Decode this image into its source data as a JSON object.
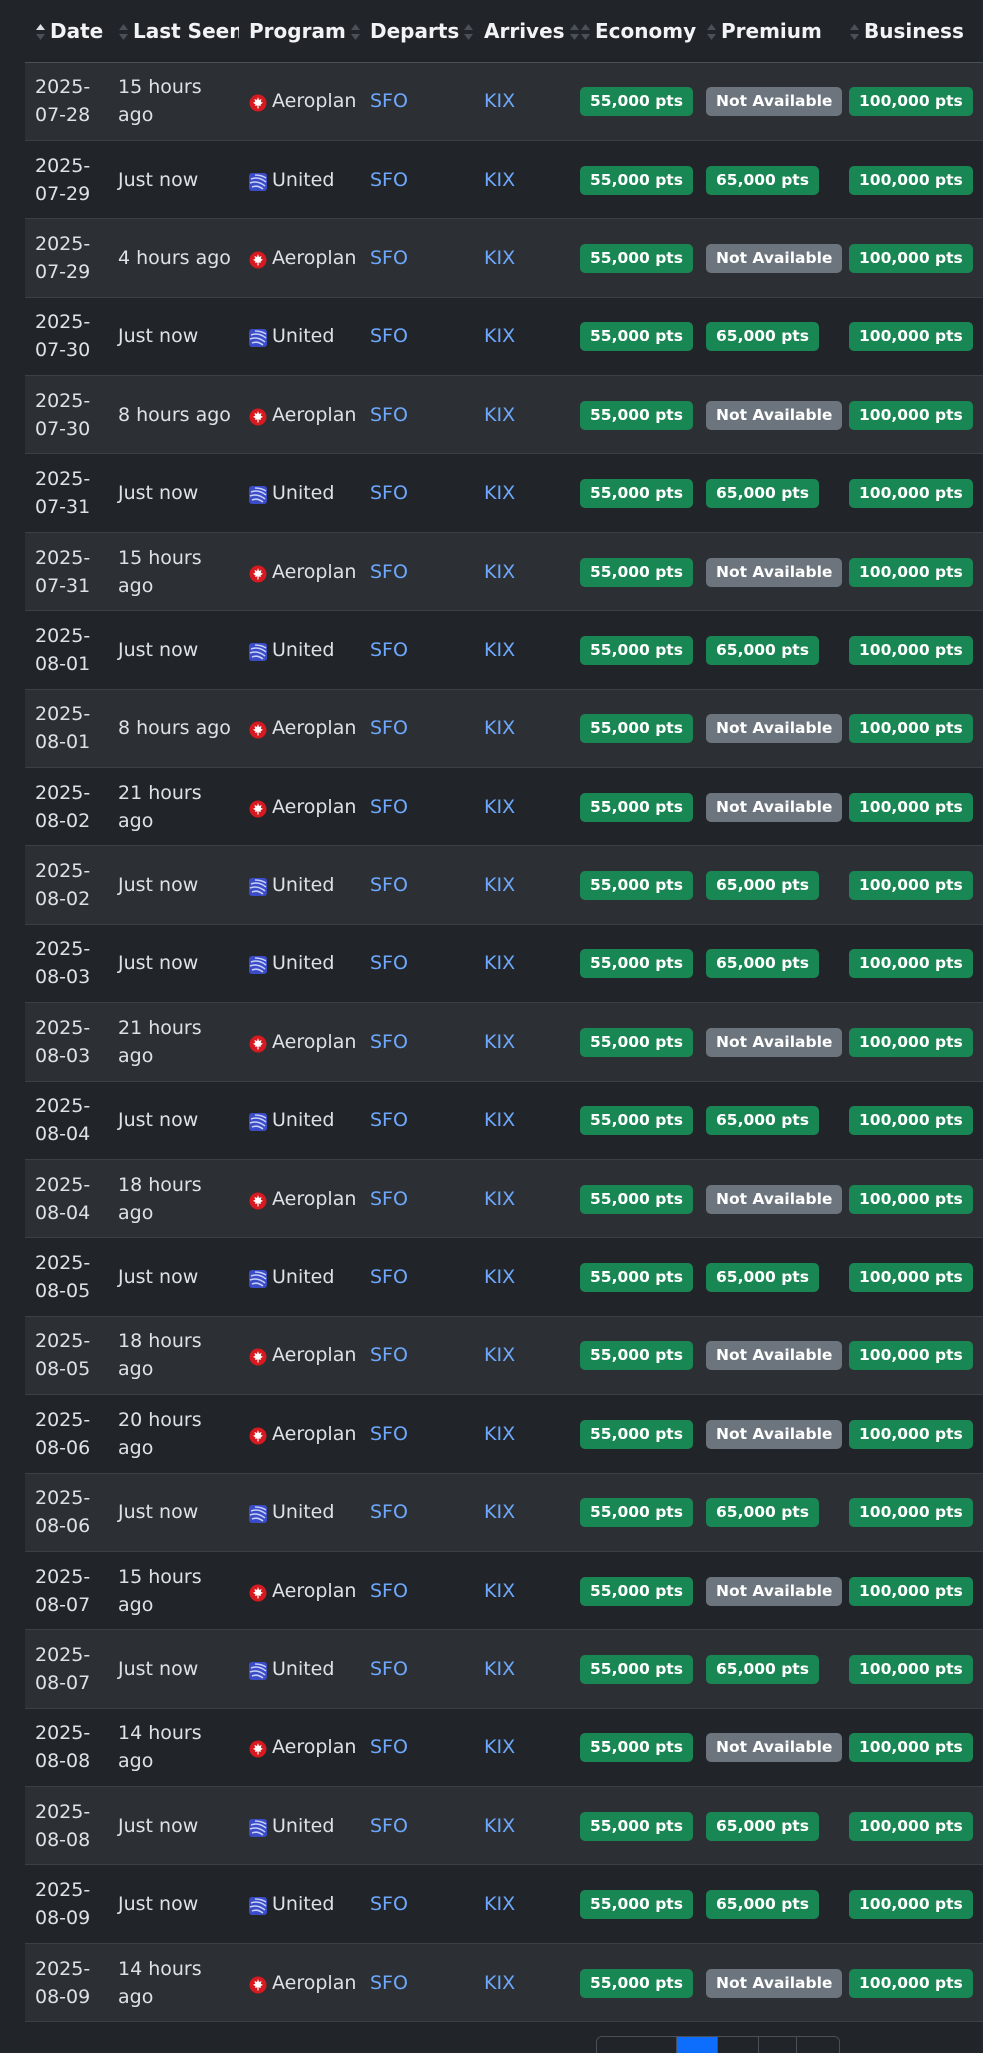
{
  "columns": {
    "date": "Date",
    "last_seen": "Last Seen",
    "program": "Program",
    "departs": "Departs",
    "arrives": "Arrives",
    "economy": "Economy",
    "premium": "Premium",
    "business": "Business"
  },
  "colors": {
    "available": "#198754",
    "not_available": "#6c757d",
    "link": "#6ea8fe",
    "active_page": "#0d6efd"
  },
  "icons": {
    "aeroplan": "aeroplan-maple-leaf-icon",
    "united": "united-globe-icon"
  },
  "rows": [
    {
      "date": "2025-\n07-28",
      "last_seen": "15 hours\nago",
      "program": "Aeroplan",
      "departs": "SFO",
      "arrives": "KIX",
      "economy": "55,000 pts",
      "premium": "Not Available",
      "business": "100,000 pts"
    },
    {
      "date": "2025-\n07-29",
      "last_seen": "Just now",
      "program": "United",
      "departs": "SFO",
      "arrives": "KIX",
      "economy": "55,000 pts",
      "premium": "65,000 pts",
      "business": "100,000 pts"
    },
    {
      "date": "2025-\n07-29",
      "last_seen": "4 hours ago",
      "program": "Aeroplan",
      "departs": "SFO",
      "arrives": "KIX",
      "economy": "55,000 pts",
      "premium": "Not Available",
      "business": "100,000 pts"
    },
    {
      "date": "2025-\n07-30",
      "last_seen": "Just now",
      "program": "United",
      "departs": "SFO",
      "arrives": "KIX",
      "economy": "55,000 pts",
      "premium": "65,000 pts",
      "business": "100,000 pts"
    },
    {
      "date": "2025-\n07-30",
      "last_seen": "8 hours ago",
      "program": "Aeroplan",
      "departs": "SFO",
      "arrives": "KIX",
      "economy": "55,000 pts",
      "premium": "Not Available",
      "business": "100,000 pts"
    },
    {
      "date": "2025-\n07-31",
      "last_seen": "Just now",
      "program": "United",
      "departs": "SFO",
      "arrives": "KIX",
      "economy": "55,000 pts",
      "premium": "65,000 pts",
      "business": "100,000 pts"
    },
    {
      "date": "2025-\n07-31",
      "last_seen": "15 hours\nago",
      "program": "Aeroplan",
      "departs": "SFO",
      "arrives": "KIX",
      "economy": "55,000 pts",
      "premium": "Not Available",
      "business": "100,000 pts"
    },
    {
      "date": "2025-\n08-01",
      "last_seen": "Just now",
      "program": "United",
      "departs": "SFO",
      "arrives": "KIX",
      "economy": "55,000 pts",
      "premium": "65,000 pts",
      "business": "100,000 pts"
    },
    {
      "date": "2025-\n08-01",
      "last_seen": "8 hours ago",
      "program": "Aeroplan",
      "departs": "SFO",
      "arrives": "KIX",
      "economy": "55,000 pts",
      "premium": "Not Available",
      "business": "100,000 pts"
    },
    {
      "date": "2025-\n08-02",
      "last_seen": "21 hours\nago",
      "program": "Aeroplan",
      "departs": "SFO",
      "arrives": "KIX",
      "economy": "55,000 pts",
      "premium": "Not Available",
      "business": "100,000 pts"
    },
    {
      "date": "2025-\n08-02",
      "last_seen": "Just now",
      "program": "United",
      "departs": "SFO",
      "arrives": "KIX",
      "economy": "55,000 pts",
      "premium": "65,000 pts",
      "business": "100,000 pts"
    },
    {
      "date": "2025-\n08-03",
      "last_seen": "Just now",
      "program": "United",
      "departs": "SFO",
      "arrives": "KIX",
      "economy": "55,000 pts",
      "premium": "65,000 pts",
      "business": "100,000 pts"
    },
    {
      "date": "2025-\n08-03",
      "last_seen": "21 hours\nago",
      "program": "Aeroplan",
      "departs": "SFO",
      "arrives": "KIX",
      "economy": "55,000 pts",
      "premium": "Not Available",
      "business": "100,000 pts"
    },
    {
      "date": "2025-\n08-04",
      "last_seen": "Just now",
      "program": "United",
      "departs": "SFO",
      "arrives": "KIX",
      "economy": "55,000 pts",
      "premium": "65,000 pts",
      "business": "100,000 pts"
    },
    {
      "date": "2025-\n08-04",
      "last_seen": "18 hours\nago",
      "program": "Aeroplan",
      "departs": "SFO",
      "arrives": "KIX",
      "economy": "55,000 pts",
      "premium": "Not Available",
      "business": "100,000 pts"
    },
    {
      "date": "2025-\n08-05",
      "last_seen": "Just now",
      "program": "United",
      "departs": "SFO",
      "arrives": "KIX",
      "economy": "55,000 pts",
      "premium": "65,000 pts",
      "business": "100,000 pts"
    },
    {
      "date": "2025-\n08-05",
      "last_seen": "18 hours\nago",
      "program": "Aeroplan",
      "departs": "SFO",
      "arrives": "KIX",
      "economy": "55,000 pts",
      "premium": "Not Available",
      "business": "100,000 pts"
    },
    {
      "date": "2025-\n08-06",
      "last_seen": "20 hours\nago",
      "program": "Aeroplan",
      "departs": "SFO",
      "arrives": "KIX",
      "economy": "55,000 pts",
      "premium": "Not Available",
      "business": "100,000 pts"
    },
    {
      "date": "2025-\n08-06",
      "last_seen": "Just now",
      "program": "United",
      "departs": "SFO",
      "arrives": "KIX",
      "economy": "55,000 pts",
      "premium": "65,000 pts",
      "business": "100,000 pts"
    },
    {
      "date": "2025-\n08-07",
      "last_seen": "15 hours\nago",
      "program": "Aeroplan",
      "departs": "SFO",
      "arrives": "KIX",
      "economy": "55,000 pts",
      "premium": "Not Available",
      "business": "100,000 pts"
    },
    {
      "date": "2025-\n08-07",
      "last_seen": "Just now",
      "program": "United",
      "departs": "SFO",
      "arrives": "KIX",
      "economy": "55,000 pts",
      "premium": "65,000 pts",
      "business": "100,000 pts"
    },
    {
      "date": "2025-\n08-08",
      "last_seen": "14 hours\nago",
      "program": "Aeroplan",
      "departs": "SFO",
      "arrives": "KIX",
      "economy": "55,000 pts",
      "premium": "Not Available",
      "business": "100,000 pts"
    },
    {
      "date": "2025-\n08-08",
      "last_seen": "Just now",
      "program": "United",
      "departs": "SFO",
      "arrives": "KIX",
      "economy": "55,000 pts",
      "premium": "65,000 pts",
      "business": "100,000 pts"
    },
    {
      "date": "2025-\n08-09",
      "last_seen": "Just now",
      "program": "United",
      "departs": "SFO",
      "arrives": "KIX",
      "economy": "55,000 pts",
      "premium": "65,000 pts",
      "business": "100,000 pts"
    },
    {
      "date": "2025-\n08-09",
      "last_seen": "14 hours\nago",
      "program": "Aeroplan",
      "departs": "SFO",
      "arrives": "KIX",
      "economy": "55,000 pts",
      "premium": "Not Available",
      "business": "100,000 pts"
    }
  ]
}
